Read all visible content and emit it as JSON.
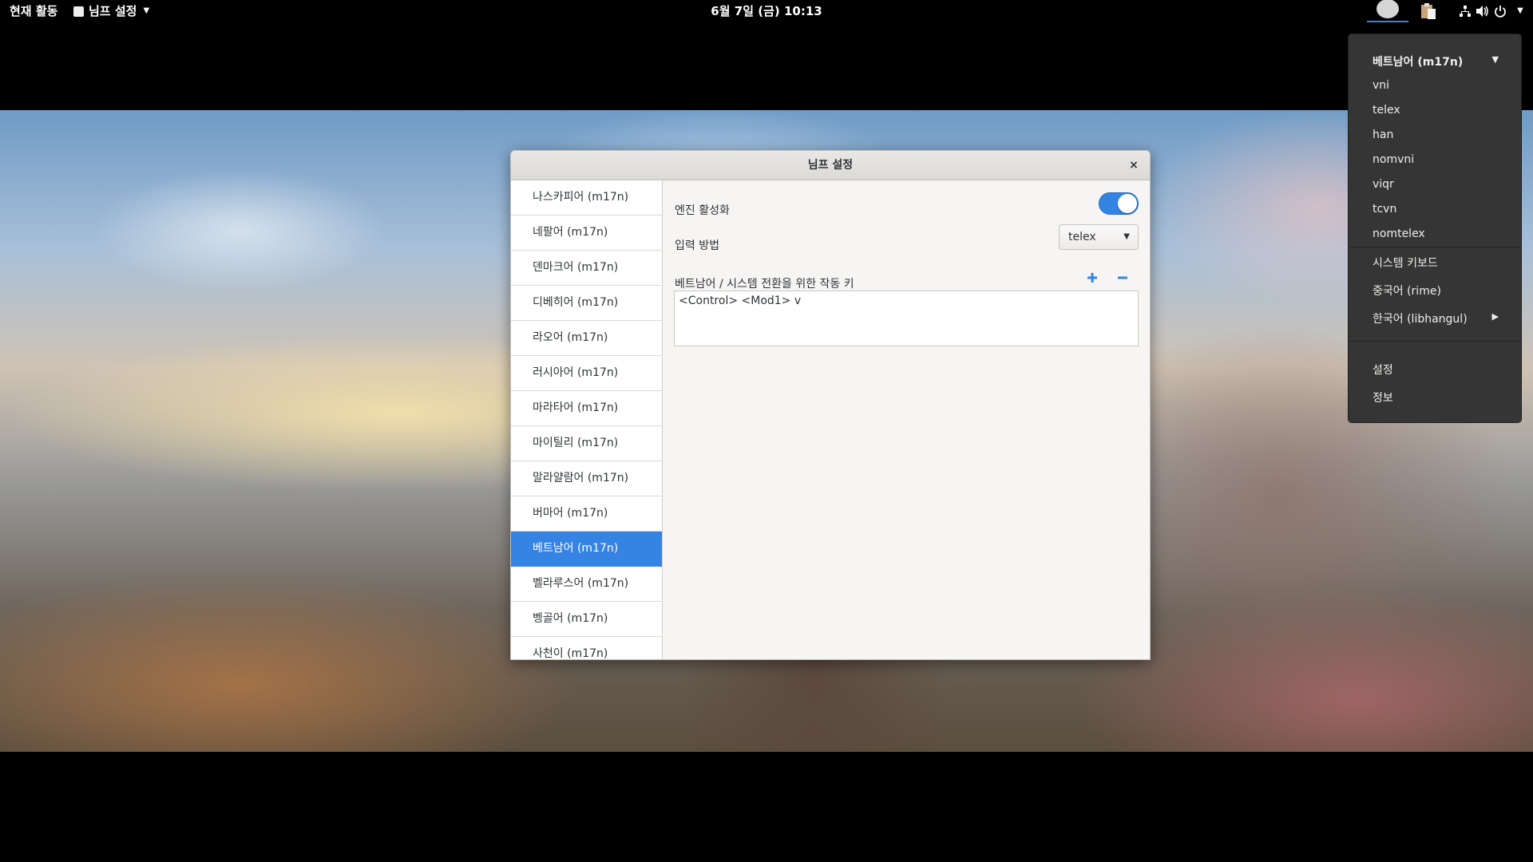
{
  "topbar": {
    "activities": "현재 활동",
    "app_menu": "님프 설정",
    "clock": "6월 7일 (금) 10:13"
  },
  "dialog": {
    "title": "님프 설정",
    "close_glyph": "×",
    "languages": [
      "나스카피어 (m17n)",
      "네팔어 (m17n)",
      "덴마크어 (m17n)",
      "디베히어 (m17n)",
      "라오어 (m17n)",
      "러시아어 (m17n)",
      "마라타어 (m17n)",
      "마이틸리 (m17n)",
      "말라얄람어 (m17n)",
      "버마어 (m17n)",
      "베트남어 (m17n)",
      "벨라루스어 (m17n)",
      "벵골어 (m17n)",
      "사천이 (m17n)"
    ],
    "selected_language": "베트남어 (m17n)",
    "engine_label": "엔진 활성화",
    "engine_enabled": true,
    "method_label": "입력 방법",
    "method_value": "telex",
    "hotkey_label": "베트남어 / 시스템 전환을 위한 작동 키",
    "hotkeys": [
      "<Control> <Mod1> v"
    ]
  },
  "popup": {
    "header": "베트남어 (m17n)",
    "methods": [
      "vni",
      "telex",
      "han",
      "nomvni",
      "viqr",
      "tcvn",
      "nomtelex"
    ],
    "others": [
      "시스템 키보드",
      "중국어 (rime)",
      "한국어 (libhangul)"
    ],
    "settings": "설정",
    "about": "정보"
  },
  "colors": {
    "accent": "#3584e4",
    "popup_bg": "#353535",
    "dialog_bg": "#f6f5f4"
  },
  "icons": {
    "ime_indicator": "circle-icon",
    "clipboard": "clipboard-icon",
    "network": "network-icon",
    "volume": "volume-icon",
    "power": "power-icon"
  }
}
